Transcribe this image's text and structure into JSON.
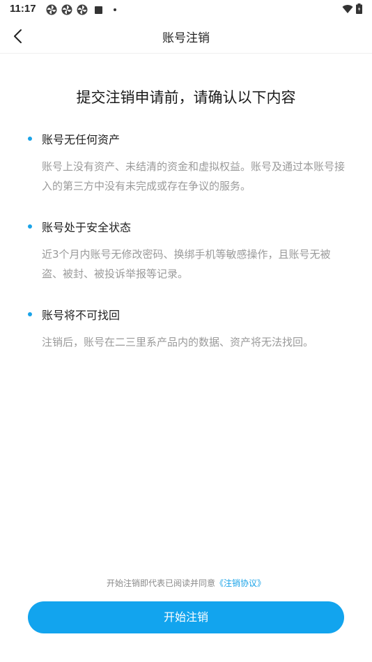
{
  "status_bar": {
    "time": "11:17",
    "notification_icons": [
      "pinwheel-icon",
      "pinwheel-icon",
      "pinwheel-icon",
      "square-icon",
      "dot-icon"
    ],
    "right_icons": [
      "wifi-icon",
      "battery-icon"
    ]
  },
  "nav": {
    "title": "账号注销",
    "back_icon": "chevron-left-icon"
  },
  "heading": "提交注销申请前，请确认以下内容",
  "sections": [
    {
      "title": "账号无任何资产",
      "description": "账号上没有资产、未结清的资金和虚拟权益。账号及通过本账号接入的第三方中没有未完成或存在争议的服务。"
    },
    {
      "title": "账号处于安全状态",
      "description": "近3个月内账号无修改密码、换绑手机等敏感操作，且账号无被盗、被封、被投诉举报等记录。"
    },
    {
      "title": "账号将不可找回",
      "description": "注销后，账号在二三里系产品内的数据、资产将无法找回。"
    }
  ],
  "footer": {
    "agreement_text": "开始注销即代表已阅读并同意",
    "agreement_link": "《注销协议》",
    "start_button": "开始注销"
  },
  "colors": {
    "accent": "#12a4ee",
    "bullet": "#1aa3e8",
    "desc_text": "#9a9a9a"
  }
}
